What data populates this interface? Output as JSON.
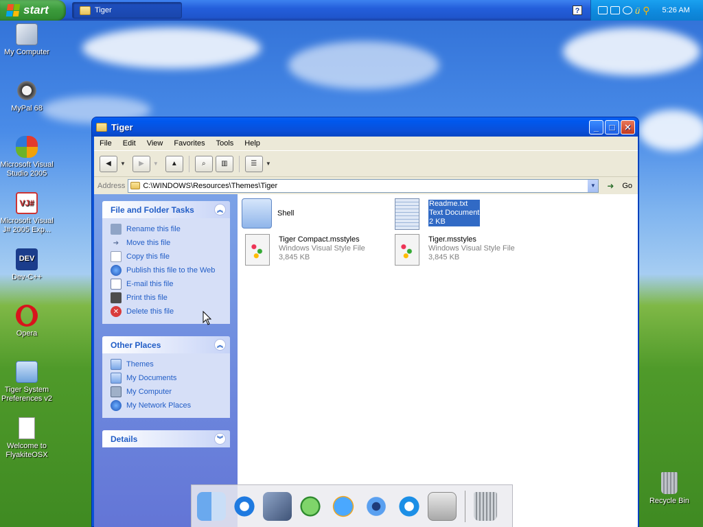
{
  "taskbar": {
    "start_label": "start",
    "task_label": "Tiger",
    "help_glyph": "?",
    "time": "5:26 AM"
  },
  "desktop_icons": [
    {
      "label": "My Computer",
      "icon": "my-computer-icon"
    },
    {
      "label": "MyPal 68",
      "icon": "mypal-icon"
    },
    {
      "label": "Microsoft Visual Studio 2005",
      "icon": "visual-studio-icon"
    },
    {
      "label": "Microsoft Visual J# 2005 Exp...",
      "icon": "visual-jsharp-icon"
    },
    {
      "label": "Dev-C++",
      "icon": "devcpp-icon"
    },
    {
      "label": "Opera",
      "icon": "opera-icon"
    },
    {
      "label": "Tiger System Preferences v2",
      "icon": "system-preferences-icon"
    },
    {
      "label": "Welcome to FlyakiteOSX",
      "icon": "document-icon"
    },
    {
      "label": "Recycle Bin",
      "icon": "recycle-bin-icon"
    }
  ],
  "window": {
    "title": "Tiger",
    "menu": [
      "File",
      "Edit",
      "View",
      "Favorites",
      "Tools",
      "Help"
    ],
    "address_label": "Address",
    "address_value": "C:\\WINDOWS\\Resources\\Themes\\Tiger",
    "go_label": "Go",
    "file_tasks": {
      "title": "File and Folder Tasks",
      "items": [
        "Rename this file",
        "Move this file",
        "Copy this file",
        "Publish this file to the Web",
        "E-mail this file",
        "Print this file",
        "Delete this file"
      ]
    },
    "other_places": {
      "title": "Other Places",
      "items": [
        "Themes",
        "My Documents",
        "My Computer",
        "My Network Places"
      ]
    },
    "details": {
      "title": "Details"
    },
    "files": [
      {
        "name": "Shell",
        "type": "",
        "size": "",
        "icon": "folder-icon"
      },
      {
        "name": "Readme.txt",
        "type": "Text Document",
        "size": "2 KB",
        "icon": "text-document-icon"
      },
      {
        "name": "Tiger Compact.msstyles",
        "type": "Windows Visual Style File",
        "size": "3,845 KB",
        "icon": "msstyles-icon"
      },
      {
        "name": "Tiger.msstyles",
        "type": "Windows Visual Style File",
        "size": "3,845 KB",
        "icon": "msstyles-icon"
      }
    ]
  },
  "dock": [
    "finder-icon",
    "internet-explorer-icon",
    "mail-icon",
    "itunes-icon",
    "quicktime-player-icon",
    "imovie-icon",
    "quicktime-icon",
    "system-preferences-icon",
    "trash-icon"
  ]
}
